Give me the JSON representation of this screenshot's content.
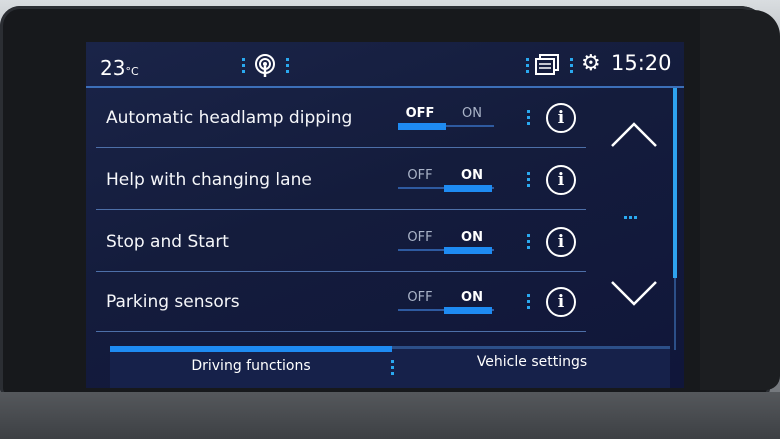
{
  "status": {
    "temperature": "23",
    "temperature_unit": "°C",
    "time": "15:20",
    "icons": [
      "connectivity-antenna-icon",
      "documents-icon",
      "gear-icon"
    ]
  },
  "settings": [
    {
      "label": "Automatic headlamp dipping",
      "off_label": "OFF",
      "on_label": "ON",
      "state": "OFF"
    },
    {
      "label": "Help with changing lane",
      "off_label": "OFF",
      "on_label": "ON",
      "state": "ON"
    },
    {
      "label": "Stop and Start",
      "off_label": "OFF",
      "on_label": "ON",
      "state": "ON"
    },
    {
      "label": "Parking sensors",
      "off_label": "OFF",
      "on_label": "ON",
      "state": "ON"
    }
  ],
  "info_glyph": "i",
  "scroll": {
    "up_icon": "chevron-up-icon",
    "down_icon": "chevron-down-icon"
  },
  "tabs": [
    {
      "label": "Driving functions",
      "active": true
    },
    {
      "label": "Vehicle settings",
      "active": false
    }
  ],
  "colors": {
    "accent": "#1e8bf2",
    "screen_bg": "#141c3c",
    "text": "#ffffff"
  }
}
